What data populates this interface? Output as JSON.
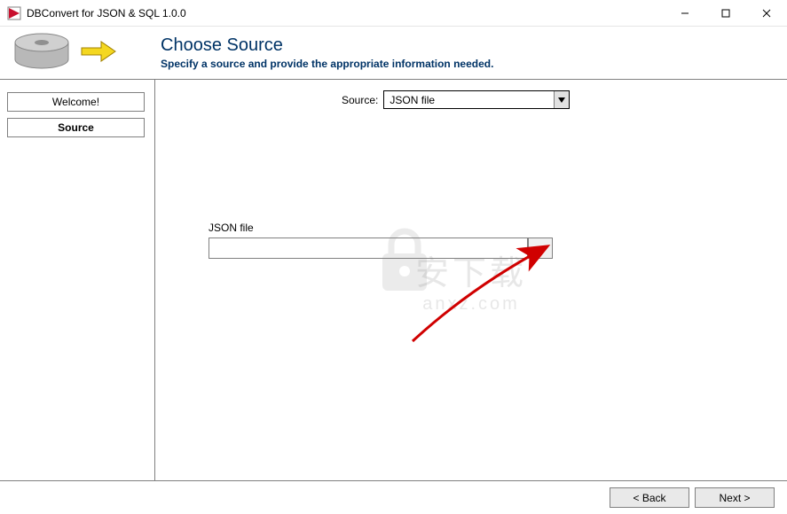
{
  "window": {
    "title": "DBConvert for JSON & SQL 1.0.0"
  },
  "header": {
    "title": "Choose Source",
    "subtitle": "Specify a source and provide the appropriate information needed."
  },
  "sidebar": {
    "steps": [
      {
        "label": "Welcome!",
        "active": false
      },
      {
        "label": "Source",
        "active": true
      }
    ]
  },
  "main": {
    "source_label": "Source:",
    "source_selected": "JSON file",
    "file_label": "JSON file",
    "file_value": "",
    "browse_label": "..."
  },
  "footer": {
    "back": "< Back",
    "next": "Next >"
  },
  "watermark": {
    "line1": "安下载",
    "line2": "anxz.com"
  }
}
